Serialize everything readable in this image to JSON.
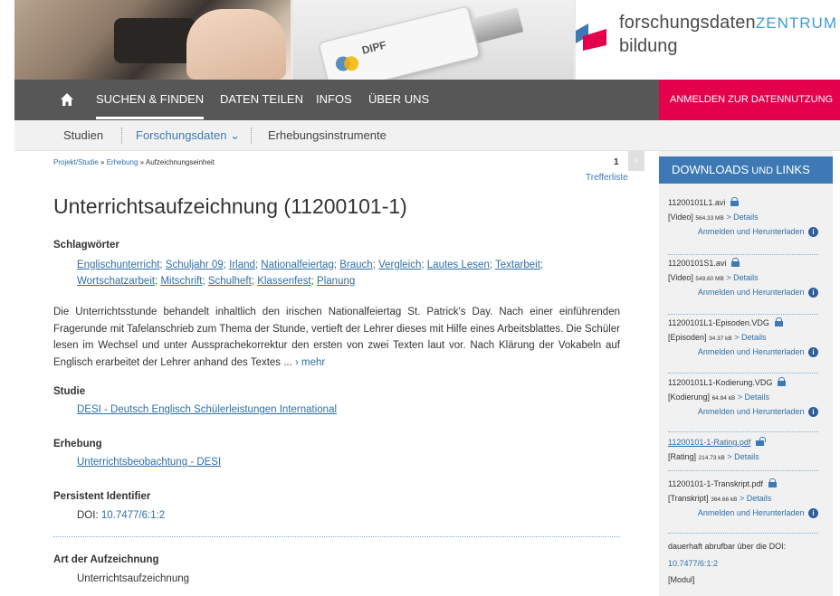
{
  "header": {
    "usb_text": "DIPF",
    "logo_line1_a": "forschungsdaten",
    "logo_line1_b": "ZENTRUM",
    "logo_line2": "bildung"
  },
  "mainnav": {
    "items": [
      "Suchen & Finden",
      "Daten teilen",
      "Infos",
      "Über uns"
    ],
    "login": "Anmelden zur Datennutzung"
  },
  "subnav": {
    "items": [
      "Studien",
      "Forschungsdaten ⌄",
      "Erhebungsinstrumente"
    ]
  },
  "breadcrumb": {
    "items": [
      "Projekt/Studie",
      "Erhebung",
      "Aufzeichnungseinheit"
    ],
    "sep": " » "
  },
  "pager": {
    "number": "1",
    "next": "›",
    "list_label": "Trefferliste"
  },
  "record": {
    "title": "Unterrichtsaufzeichnung (11200101-1)",
    "keywords_label": "Schlagwörter",
    "keywords": [
      "Englischunterricht",
      "Schuljahr 09",
      "Irland",
      "Nationalfeiertag",
      "Brauch",
      "Vergleich",
      "Lautes Lesen",
      "Textarbeit",
      "Wortschatzarbeit",
      "Mitschrift",
      "Schulheft",
      "Klassenfest",
      "Planung"
    ],
    "description": "Die Unterrichtsstunde behandelt inhaltlich den irischen Nationalfeiertag St. Patrick's Day. Nach einer einführenden Fragerunde mit Tafelanschrieb zum Thema der Stunde, vertieft der Lehrer dieses mit Hilfe eines Arbeitsblattes. Die Schüler lesen im Wechsel und unter Aussprachekorrektur den ersten von zwei Texten laut vor. Nach Klärung der Vokabeln auf Englisch erarbeitet der Lehrer anhand des Textes ...",
    "more": "› mehr",
    "study_label": "Studie",
    "study": "DESI - Deutsch Englisch Schülerleistungen International",
    "survey_label": "Erhebung",
    "survey": "Unterrichtsbeobachtung - DESI",
    "pid_label": "Persistent Identifier",
    "doi_prefix": "DOI: ",
    "doi": "10.7477/6:1:2",
    "type_label": "Art der Aufzeichnung",
    "type": "Unterrichtsaufzeichnung"
  },
  "sidebar": {
    "title_a": "Downloads",
    "title_b": " und ",
    "title_c": "Links",
    "details": "> Details",
    "download_label": "Anmelden und Herunterladen",
    "info_icon": "i",
    "files": [
      {
        "name": "11200101L1.avi",
        "kind": "[Video]",
        "size": "564.33 MB",
        "locked": true,
        "download": true
      },
      {
        "name": "11200101S1.avi",
        "kind": "[Video]",
        "size": "549.60 MB",
        "locked": true,
        "download": true
      },
      {
        "name": "11200101L1-Episoden.VDG",
        "kind": "[Episoden]",
        "size": "34.37 kB",
        "locked": true,
        "download": true
      },
      {
        "name": "11200101L1-Kodierung.VDG",
        "kind": "[Kodierung]",
        "size": "64.84 kB",
        "locked": true,
        "download": true
      },
      {
        "name": "11200101-1-Rating.pdf",
        "kind": "[Rating]",
        "size": "214.73 kB",
        "locked": false,
        "download": false
      },
      {
        "name": "11200101-1-Transkript.pdf",
        "kind": "[Transkript]",
        "size": "364.66 kB",
        "locked": true,
        "download": true
      }
    ],
    "doi_note": "dauerhaft abrufbar über die DOI:",
    "doi": "10.7477/6:1:2",
    "module": "[Modul]"
  },
  "colors": {
    "nav_bg": "#575757",
    "login_bg": "#e5004d",
    "accent": "#3d7ab5",
    "link": "#2e6fa7"
  }
}
